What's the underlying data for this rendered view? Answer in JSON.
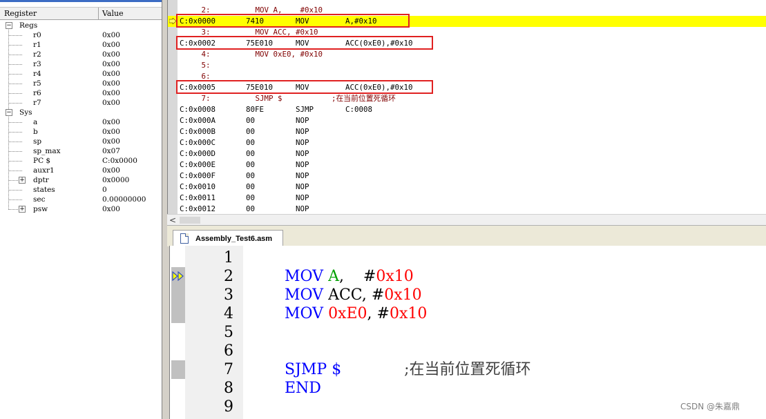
{
  "registers": {
    "header": {
      "name": "Register",
      "value": "Value"
    },
    "rows": [
      {
        "name": "Regs",
        "value": "",
        "group": true,
        "expander": "−"
      },
      {
        "name": "r0",
        "value": "0x00"
      },
      {
        "name": "r1",
        "value": "0x00"
      },
      {
        "name": "r2",
        "value": "0x00"
      },
      {
        "name": "r3",
        "value": "0x00"
      },
      {
        "name": "r4",
        "value": "0x00"
      },
      {
        "name": "r5",
        "value": "0x00"
      },
      {
        "name": "r6",
        "value": "0x00"
      },
      {
        "name": "r7",
        "value": "0x00"
      },
      {
        "name": "Sys",
        "value": "",
        "group": true,
        "expander": "−"
      },
      {
        "name": "a",
        "value": "0x00"
      },
      {
        "name": "b",
        "value": "0x00"
      },
      {
        "name": "sp",
        "value": "0x00"
      },
      {
        "name": "sp_max",
        "value": "0x07"
      },
      {
        "name": "PC  $",
        "value": "C:0x0000"
      },
      {
        "name": "auxr1",
        "value": "0x00"
      },
      {
        "name": "dptr",
        "value": "0x0000",
        "expander": "+"
      },
      {
        "name": "states",
        "value": "0"
      },
      {
        "name": "sec",
        "value": "0.00000000"
      },
      {
        "name": "psw",
        "value": "0x00",
        "expander": "+"
      }
    ]
  },
  "disassembly": {
    "lines": [
      {
        "kind": "src",
        "text": "     2:          MOV A,    #0x10"
      },
      {
        "kind": "asm",
        "addr": "C:0x0000",
        "opcode": "7410",
        "mnemonic": "MOV",
        "operands": "A,#0x10",
        "current": true,
        "boxed": true
      },
      {
        "kind": "src",
        "text": "     3:          MOV ACC, #0x10"
      },
      {
        "kind": "asm",
        "addr": "C:0x0002",
        "opcode": "75E010",
        "mnemonic": "MOV",
        "operands": "ACC(0xE0),#0x10",
        "boxed": true
      },
      {
        "kind": "src",
        "text": "     4:          MOV 0xE0, #0x10"
      },
      {
        "kind": "src",
        "text": "     5:"
      },
      {
        "kind": "src",
        "text": "     6:"
      },
      {
        "kind": "asm",
        "addr": "C:0x0005",
        "opcode": "75E010",
        "mnemonic": "MOV",
        "operands": "ACC(0xE0),#0x10",
        "boxed": true
      },
      {
        "kind": "src",
        "text": "     7:          SJMP $           ;在当前位置死循环"
      },
      {
        "kind": "asm",
        "addr": "C:0x0008",
        "opcode": "80FE",
        "mnemonic": "SJMP",
        "operands": "C:0008"
      },
      {
        "kind": "asm",
        "addr": "C:0x000A",
        "opcode": "00",
        "mnemonic": "NOP",
        "operands": ""
      },
      {
        "kind": "asm",
        "addr": "C:0x000B",
        "opcode": "00",
        "mnemonic": "NOP",
        "operands": ""
      },
      {
        "kind": "asm",
        "addr": "C:0x000C",
        "opcode": "00",
        "mnemonic": "NOP",
        "operands": ""
      },
      {
        "kind": "asm",
        "addr": "C:0x000D",
        "opcode": "00",
        "mnemonic": "NOP",
        "operands": ""
      },
      {
        "kind": "asm",
        "addr": "C:0x000E",
        "opcode": "00",
        "mnemonic": "NOP",
        "operands": ""
      },
      {
        "kind": "asm",
        "addr": "C:0x000F",
        "opcode": "00",
        "mnemonic": "NOP",
        "operands": ""
      },
      {
        "kind": "asm",
        "addr": "C:0x0010",
        "opcode": "00",
        "mnemonic": "NOP",
        "operands": ""
      },
      {
        "kind": "asm",
        "addr": "C:0x0011",
        "opcode": "00",
        "mnemonic": "NOP",
        "operands": ""
      },
      {
        "kind": "asm",
        "addr": "C:0x0012",
        "opcode": "00",
        "mnemonic": "NOP",
        "operands": ""
      }
    ],
    "scroll_left_glyph": "<"
  },
  "editor": {
    "tab_label": "Assembly_Test6.asm",
    "lines": [
      {
        "no": "1",
        "parts": []
      },
      {
        "no": "2",
        "parts": [
          {
            "t": "MOV ",
            "c": "kw"
          },
          {
            "t": "A",
            "c": "reg"
          },
          {
            "t": ",    ",
            "c": "plain"
          },
          {
            "t": "#",
            "c": "plain"
          },
          {
            "t": "0x10",
            "c": "num"
          }
        ]
      },
      {
        "no": "3",
        "parts": [
          {
            "t": "MOV ",
            "c": "kw"
          },
          {
            "t": "ACC, ",
            "c": "plain"
          },
          {
            "t": "#",
            "c": "plain"
          },
          {
            "t": "0x10",
            "c": "num"
          }
        ]
      },
      {
        "no": "4",
        "parts": [
          {
            "t": "MOV ",
            "c": "kw"
          },
          {
            "t": "0xE0",
            "c": "num"
          },
          {
            "t": ", ",
            "c": "plain"
          },
          {
            "t": "#",
            "c": "plain"
          },
          {
            "t": "0x10",
            "c": "num"
          }
        ]
      },
      {
        "no": "5",
        "parts": []
      },
      {
        "no": "6",
        "parts": []
      },
      {
        "no": "7",
        "parts": [
          {
            "t": "SJMP ",
            "c": "kw"
          },
          {
            "t": "$",
            "c": "kw"
          },
          {
            "t": "             ",
            "c": "plain"
          },
          {
            "t": ";在当前位置死循环",
            "c": "comment"
          }
        ]
      },
      {
        "no": "8",
        "parts": [
          {
            "t": "END",
            "c": "kw"
          }
        ]
      },
      {
        "no": "9",
        "parts": []
      }
    ]
  },
  "watermark": "CSDN @朱嘉鼎",
  "colors": {
    "current_line": "#ffff00",
    "highlight_box": "#e02020",
    "keyword": "#0000ff",
    "register": "#00a000",
    "number": "#ff0000"
  }
}
